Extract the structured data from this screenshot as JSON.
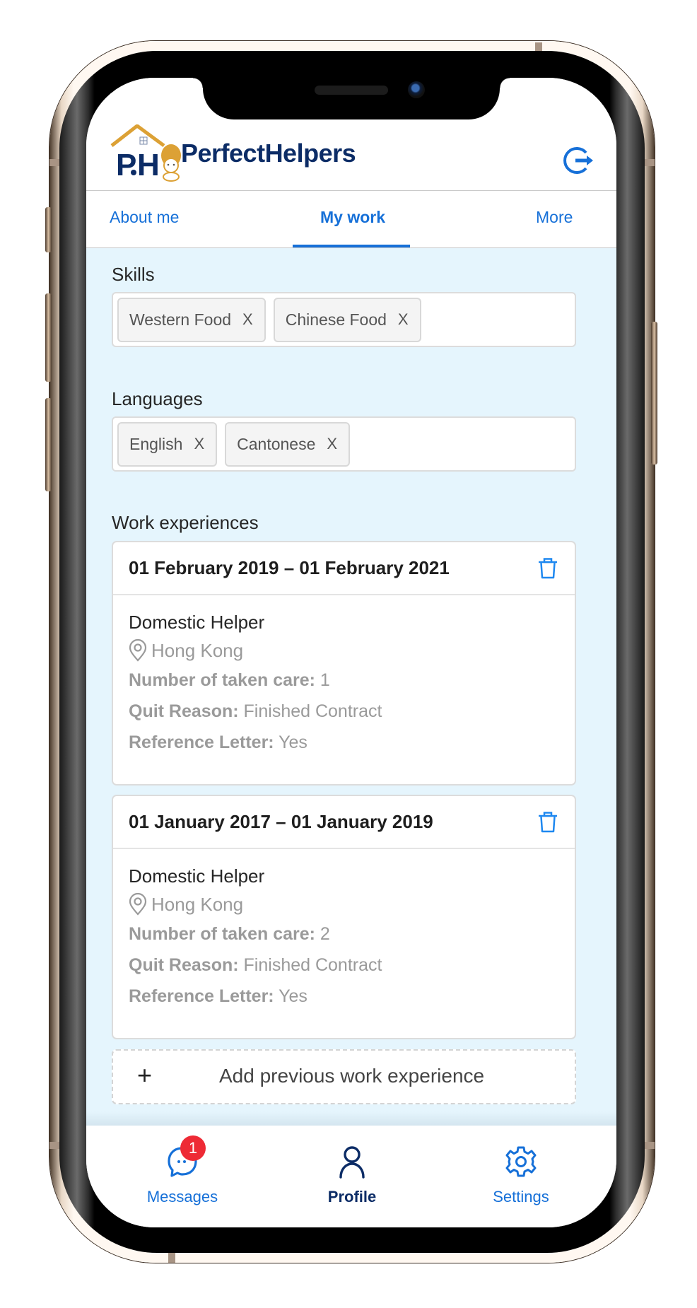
{
  "app": {
    "brand_name": "PerfectHelpers",
    "logo_initials": "P.H",
    "colors": {
      "accent": "#1670d8",
      "brand_navy": "#0c2c66",
      "brand_gold": "#dca135",
      "content_bg": "#e5f5fd",
      "badge_red": "#ee2a35"
    }
  },
  "header": {
    "logout_icon": "logout-icon"
  },
  "tabs": [
    {
      "label": "About me",
      "active": false
    },
    {
      "label": "My work",
      "active": true
    },
    {
      "label": "More",
      "active": false
    }
  ],
  "skills": {
    "label": "Skills",
    "tags": [
      {
        "label": "Western Food",
        "remove": "X"
      },
      {
        "label": "Chinese Food",
        "remove": "X"
      }
    ]
  },
  "languages": {
    "label": "Languages",
    "tags": [
      {
        "label": "English",
        "remove": "X"
      },
      {
        "label": "Cantonese",
        "remove": "X"
      }
    ]
  },
  "work_experiences": {
    "label": "Work experiences",
    "items": [
      {
        "date_range": "01 February 2019 – 01 February 2021",
        "job_title": "Domestic Helper",
        "location": "Hong Kong",
        "care_label": "Number of taken care:",
        "care_value": "1",
        "quit_label": "Quit Reason:",
        "quit_value": "Finished Contract",
        "ref_label": "Reference Letter:",
        "ref_value": "Yes"
      },
      {
        "date_range": "01 January 2017 – 01 January 2019",
        "job_title": "Domestic Helper",
        "location": "Hong Kong",
        "care_label": "Number of taken care:",
        "care_value": "2",
        "quit_label": "Quit Reason:",
        "quit_value": "Finished Contract",
        "ref_label": "Reference Letter:",
        "ref_value": "Yes"
      }
    ],
    "add_plus": "+",
    "add_label": "Add previous work experience"
  },
  "bottom_nav": [
    {
      "label": "Messages",
      "icon": "chat-bubble-icon",
      "badge": "1",
      "active": false
    },
    {
      "label": "Profile",
      "icon": "user-icon",
      "active": true
    },
    {
      "label": "Settings",
      "icon": "gear-icon",
      "active": false
    }
  ]
}
